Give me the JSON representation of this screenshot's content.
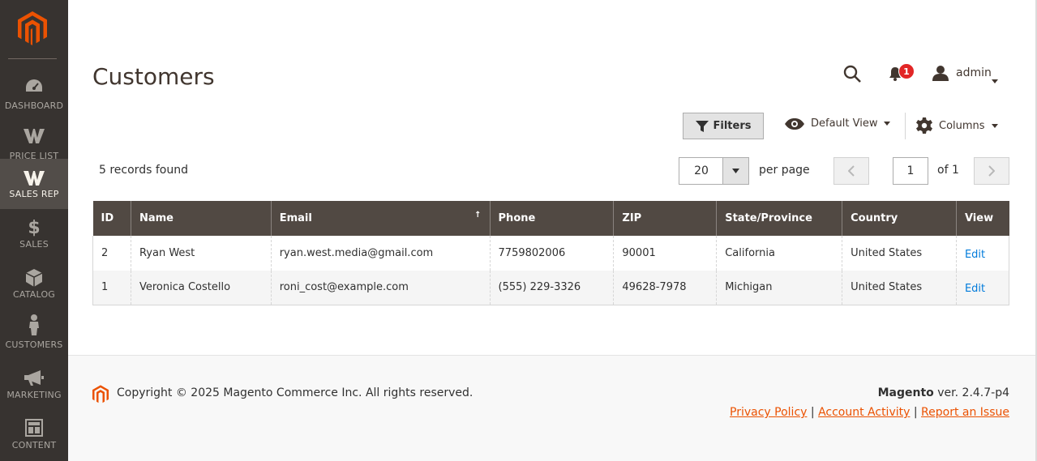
{
  "brand": {
    "accent": "#eb5202",
    "sidebar_bg": "#373330",
    "header_bg": "#514943",
    "link": "#007bdb"
  },
  "sidebar": {
    "items": [
      {
        "label": "DASHBOARD",
        "icon": "dashboard-icon"
      },
      {
        "label": "PRICE LIST",
        "icon": "w-logo-icon"
      },
      {
        "label": "SALES REP",
        "icon": "w-logo-icon",
        "active": true
      },
      {
        "label": "SALES",
        "icon": "dollar-icon"
      },
      {
        "label": "CATALOG",
        "icon": "box-icon"
      },
      {
        "label": "CUSTOMERS",
        "icon": "person-icon"
      },
      {
        "label": "MARKETING",
        "icon": "megaphone-icon"
      },
      {
        "label": "CONTENT",
        "icon": "layout-icon"
      }
    ]
  },
  "header": {
    "title": "Customers",
    "notifications_count": "1",
    "user_name": "admin"
  },
  "toolbar": {
    "filters_label": "Filters",
    "view_label": "Default View",
    "columns_label": "Columns",
    "records_found": "5 records found",
    "per_page_value": "20",
    "per_page_label": "per page",
    "page_current": "1",
    "page_of": "of 1"
  },
  "table": {
    "columns": [
      "ID",
      "Name",
      "Email",
      "Phone",
      "ZIP",
      "State/Province",
      "Country",
      "View"
    ],
    "sorted_column": "Email",
    "rows": [
      {
        "id": "2",
        "name": "Ryan West",
        "email": "ryan.west.media@gmail.com",
        "phone": "7759802006",
        "zip": "90001",
        "state": "California",
        "country": "United States",
        "action": "Edit"
      },
      {
        "id": "1",
        "name": "Veronica Costello",
        "email": "roni_cost@example.com",
        "phone": "(555) 229-3326",
        "zip": "49628-7978",
        "state": "Michigan",
        "country": "United States",
        "action": "Edit"
      }
    ]
  },
  "footer": {
    "copyright": "Copyright © 2025 Magento Commerce Inc. All rights reserved.",
    "product": "Magento",
    "version": " ver. 2.4.7-p4",
    "links": [
      "Privacy Policy",
      "Account Activity",
      "Report an Issue"
    ],
    "separator": " |"
  }
}
